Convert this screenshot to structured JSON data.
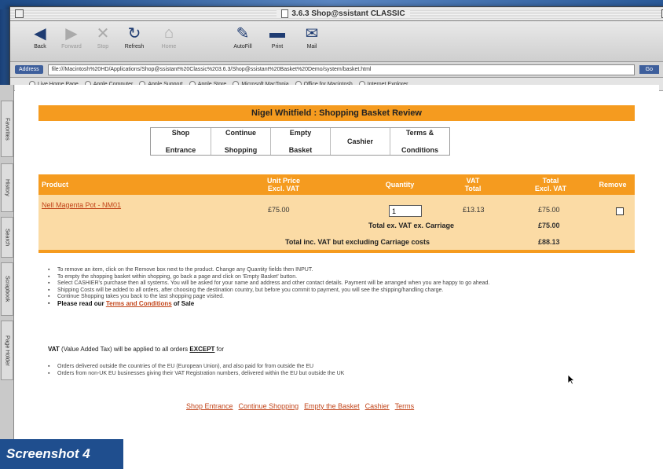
{
  "window": {
    "title": "3.6.3 Shop@ssistant CLASSIC"
  },
  "toolbar": {
    "buttons": [
      {
        "label": "Back",
        "glyph": "◀",
        "dim": false
      },
      {
        "label": "Forward",
        "glyph": "▶",
        "dim": true
      },
      {
        "label": "Stop",
        "glyph": "✕",
        "dim": true
      },
      {
        "label": "Refresh",
        "glyph": "↻",
        "dim": false
      },
      {
        "label": "Home",
        "glyph": "⌂",
        "dim": true
      },
      {
        "label": "AutoFill",
        "glyph": "✎",
        "dim": false
      },
      {
        "label": "Print",
        "glyph": "▬",
        "dim": false
      },
      {
        "label": "Mail",
        "glyph": "✉",
        "dim": false
      }
    ],
    "brand_glyph": "e"
  },
  "address": {
    "label": "Address",
    "url": "file:///Macintosh%20HD/Applications/Shop@ssistant%20Classic%203.6.3/Shop@ssistant%20Basket%20Demo/system/basket.html",
    "go": "Go"
  },
  "favorites": [
    "Live Home Page",
    "Apple Computer",
    "Apple Support",
    "Apple Store",
    "Microsoft MacTopia",
    "Office for Macintosh",
    "Internet Explorer"
  ],
  "sidetabs": [
    "Favorites",
    "History",
    "Search",
    "Scrapbook",
    "Page Holder"
  ],
  "page": {
    "header": "Nigel Whitfield : Shopping Basket Review",
    "nav": [
      {
        "line1": "Shop",
        "line2": "Entrance"
      },
      {
        "line1": "Continue",
        "line2": "Shopping"
      },
      {
        "line1": "Empty",
        "line2": "Basket"
      },
      {
        "line1": "Cashier",
        "line2": ""
      },
      {
        "line1": "Terms &",
        "line2": "Conditions"
      }
    ],
    "columns": {
      "product": "Product",
      "unit_price_1": "Unit Price",
      "unit_price_2": "Excl. VAT",
      "quantity": "Quantity",
      "vat_1": "VAT",
      "vat_2": "Total",
      "total_1": "Total",
      "total_2": "Excl. VAT",
      "remove": "Remove"
    },
    "row": {
      "product": "Nell Magenta Pot - NM01",
      "unit_price": "£75.00",
      "quantity": "1",
      "vat": "£13.13",
      "total": "£75.00"
    },
    "totals": {
      "ex_label": "Total ex. VAT ex. Carriage",
      "ex_value": "£75.00",
      "inc_label": "Total inc. VAT but excluding Carriage costs",
      "inc_value": "£88.13"
    },
    "bullets": [
      "To remove an item, click on the Remove box next to the product. Change any Quantity fields then INPUT.",
      "To empty the shopping basket within shopping, go back a page and click on 'Empty Basket' button.",
      "Select CASHIER's purchase then all systems. You will be asked for your name and address and other contact details. Payment will be arranged when you are happy to go ahead.",
      "Shipping Costs will be added to all orders, after choosing the destination country, but before you commit to payment, you will see the shipping/handling charge.",
      "Continue Shopping takes you back to the last shopping page visited."
    ],
    "read_prefix": "Please read our",
    "read_link": "Terms and Conditions",
    "read_suffix": "of Sale",
    "vat_prefix": "VAT",
    "vat_middle": "(Value Added Tax) will be applied to all orders",
    "vat_except": "EXCEPT",
    "vat_suffix": "for",
    "vat_bullets": [
      "Orders delivered outside the countries of the EU (European Union), and also paid for from outside the EU",
      "Orders from non-UK EU businesses giving their VAT Registration numbers, delivered within the EU but outside the UK"
    ],
    "footer_links": [
      "Shop Entrance",
      "Continue Shopping",
      "Empty the Basket",
      "Cashier",
      "Terms"
    ]
  },
  "caption": "Screenshot 4",
  "colors": {
    "accent": "#f59b1f",
    "row_bg": "#fbdba5",
    "link": "#c2451a",
    "caption_bg": "#1f4e8e"
  }
}
